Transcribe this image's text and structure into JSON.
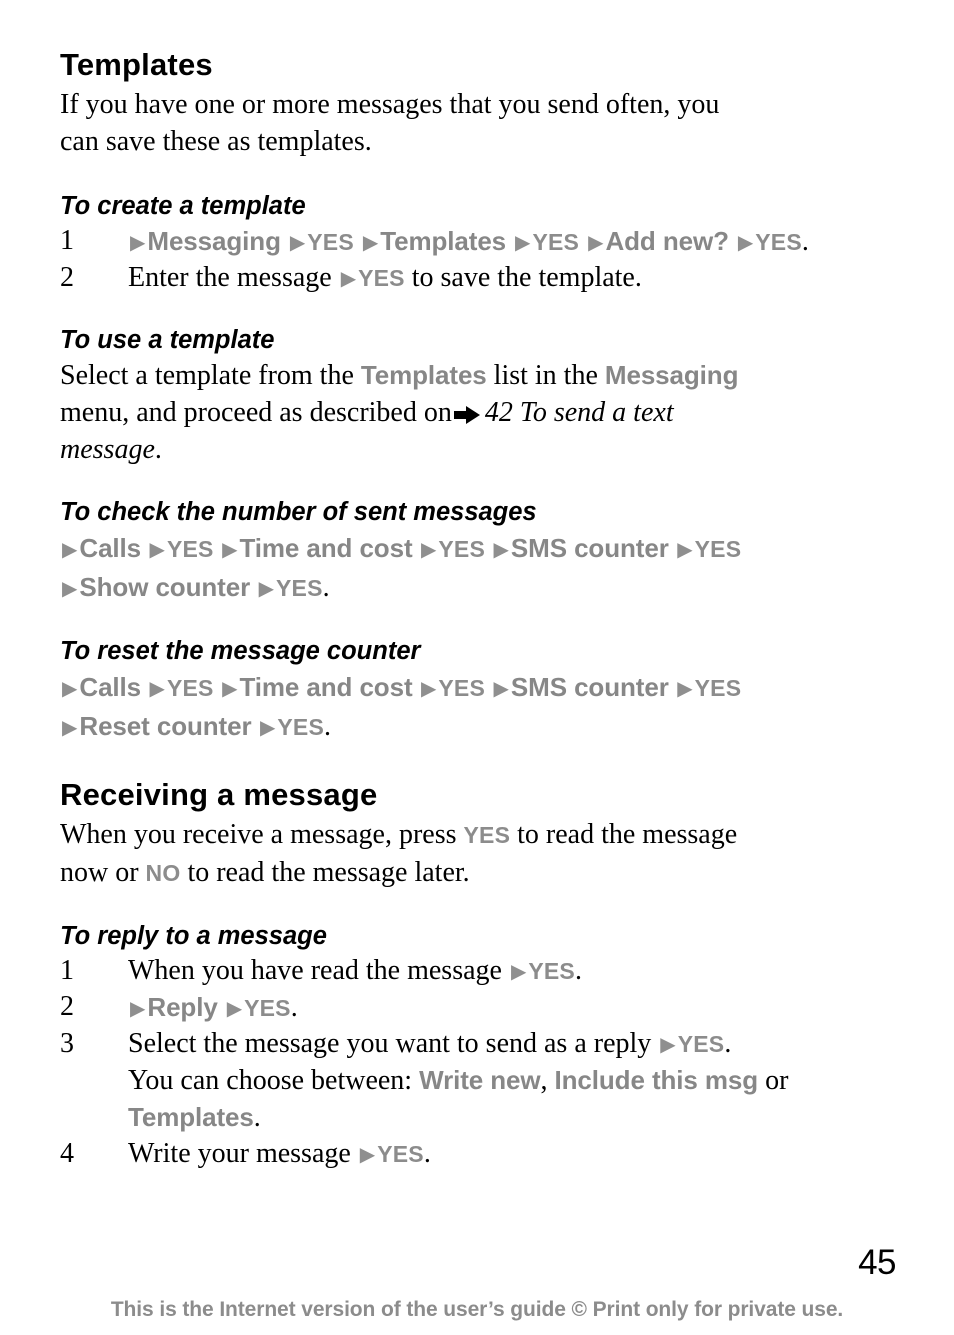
{
  "colors": {
    "ui_gray": "#878787",
    "footer_gray": "#8c8c8c",
    "text_black": "#000000",
    "background": "#ffffff"
  },
  "icons": {
    "nav_triangle": "▶",
    "crossref_arrow": "➡"
  },
  "sections": {
    "templates": {
      "heading": "Templates",
      "intro_line1": "If you have one or more messages that you send often, you",
      "intro_line2": "can save these as templates."
    },
    "create_template": {
      "heading": "To create a template",
      "steps": [
        {
          "num": "1",
          "keys": [
            "Messaging",
            "YES",
            "Templates",
            "YES",
            "Add new?",
            "YES"
          ],
          "trailing_period": "."
        },
        {
          "num": "2",
          "text_before": "Enter the message",
          "key": "YES",
          "text_after": "to save the template."
        }
      ]
    },
    "use_template": {
      "heading": "To use a template",
      "line1_a": "Select a template from the",
      "line1_key1": "Templates",
      "line1_b": "list in the",
      "line1_key2": "Messaging",
      "line2_a": "menu, and proceed as described on",
      "xref_page": "42",
      "xref_title": "To send a text",
      "line3_italic": "message",
      "line3_period": "."
    },
    "check_counter": {
      "heading": "To check the number of sent messages",
      "line1_keys": [
        "Calls",
        "YES",
        "Time and cost",
        "YES",
        "SMS counter",
        "YES"
      ],
      "line2_keys": [
        "Show counter",
        "YES"
      ],
      "line2_period": "."
    },
    "reset_counter": {
      "heading": "To reset the message counter",
      "line1_keys": [
        "Calls",
        "YES",
        "Time and cost",
        "YES",
        "SMS counter",
        "YES"
      ],
      "line2_keys": [
        "Reset counter",
        "YES"
      ],
      "line2_period": "."
    },
    "receiving": {
      "heading": "Receiving a message",
      "line1_a": "When you receive a message, press",
      "line1_key": "YES",
      "line1_b": "to read the message",
      "line2_a": "now or",
      "line2_key": "NO",
      "line2_b": "to read the message later."
    },
    "reply": {
      "heading": "To reply to a message",
      "steps": [
        {
          "num": "1",
          "text_before": "When you have read the message",
          "key": "YES",
          "period": "."
        },
        {
          "num": "2",
          "keys": [
            "Reply",
            "YES"
          ],
          "period": "."
        },
        {
          "num": "3",
          "line1_text": "Select the message you want to send as a reply",
          "line1_key": "YES",
          "line1_period": ".",
          "line2_text": "You can choose between:",
          "line2_key1": "Write new",
          "line2_comma": ",",
          "line2_key2": "Include this msg",
          "line2_or": "or",
          "line3_key3": "Templates",
          "line3_period": "."
        },
        {
          "num": "4",
          "text_before": "Write your message",
          "key": "YES",
          "period": "."
        }
      ]
    }
  },
  "page_number": "45",
  "footer": {
    "text": "This is the Internet version of the user’s guide © Print only for private use."
  }
}
